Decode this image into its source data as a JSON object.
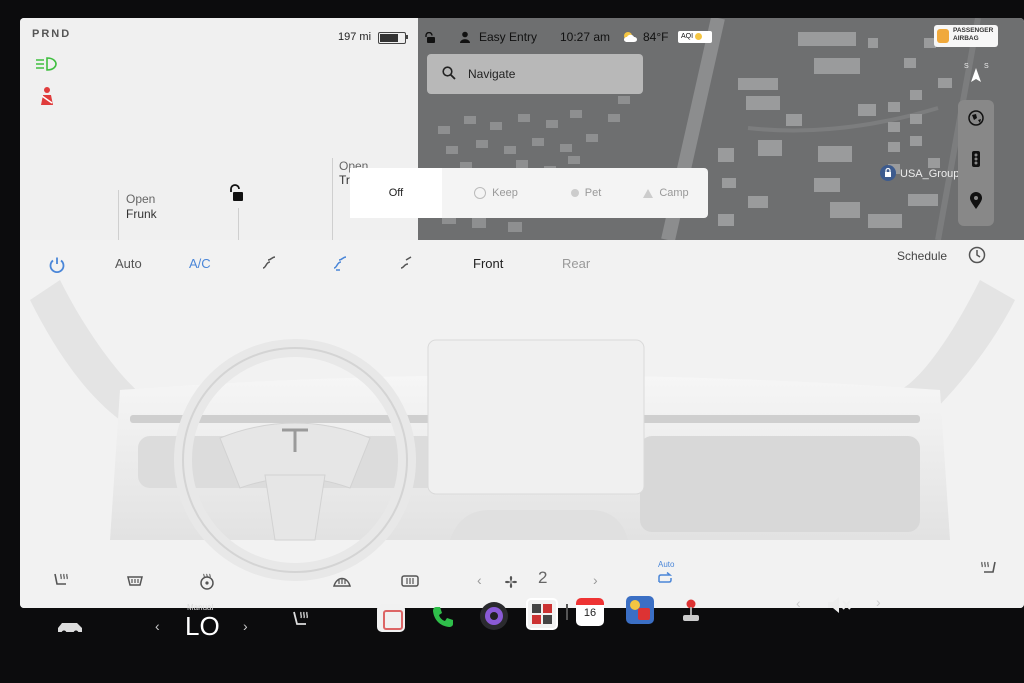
{
  "status": {
    "gear_indicator": "PRND",
    "range": "197 mi",
    "battery_level": 0.75
  },
  "car": {
    "frunk_label": "Open",
    "frunk_name": "Frunk",
    "trunk_label": "Open",
    "trunk_name": "Tr"
  },
  "map_header": {
    "profile": "Easy Entry",
    "time": "10:27 am",
    "temperature": "84°F",
    "aqi": "AQI",
    "airbag_line1": "PASSENGER",
    "airbag_line2": "AIRBAG"
  },
  "navigate_placeholder": "Navigate",
  "map_poi": "USA_Group",
  "compass": {
    "letters": "N",
    "speed_label": "S"
  },
  "defrost_options": [
    "Off",
    "Keep",
    "Pet",
    "Camp"
  ],
  "climate": {
    "auto_label": "Auto",
    "ac_label": "A/C",
    "front_label": "Front",
    "rear_label": "Rear",
    "schedule_label": "Schedule",
    "fan_speed": "2",
    "recirc_auto": "Auto"
  },
  "taskbar": {
    "temp_mode": "Manual",
    "temp_value": "LO",
    "calendar_day": "16"
  },
  "colors": {
    "accent_blue": "#4a86d8",
    "map_bg": "#6e6f70",
    "lamp_green": "#3fbf3f",
    "seatbelt_red": "#e03c3c",
    "phone_green": "#2fbf4a"
  }
}
